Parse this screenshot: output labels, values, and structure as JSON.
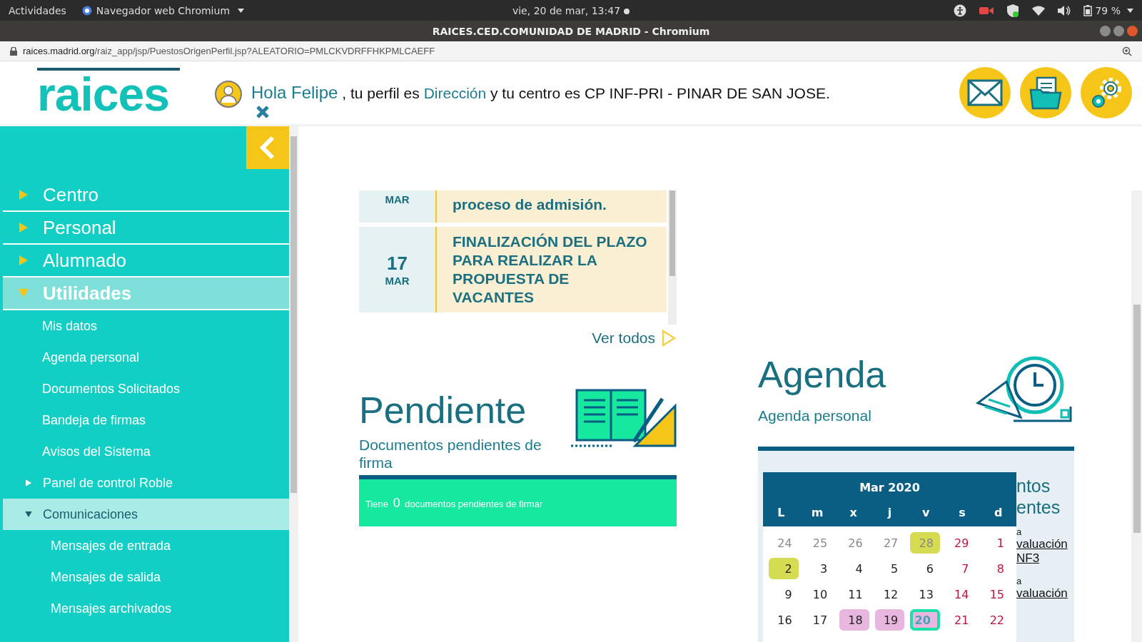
{
  "system_bar": {
    "activities": "Actividades",
    "app_menu": "Navegador web Chromium",
    "clock": "vie, 20 de mar, 13:47",
    "battery": "79 %"
  },
  "window": {
    "title": "RAICES.CED.COMUNIDAD DE MADRID - Chromium"
  },
  "address_bar": {
    "domain": "raices.madrid.org",
    "path": "/raiz_app/jsp/PuestosOrigenPerfil.jsp?ALEATORIO=PMLCKVDRFFHKPMLCAEFF"
  },
  "header": {
    "logo": "raices",
    "greeting": "Hola Felipe",
    "text_1": ", tu perfil es",
    "profile": "Dirección",
    "text_2": "y tu centro es CP INF-PRI - PINAR DE SAN JOSE."
  },
  "sidebar": {
    "items": [
      {
        "label": "Centro",
        "expanded": false,
        "selected": false
      },
      {
        "label": "Personal",
        "expanded": false,
        "selected": false
      },
      {
        "label": "Alumnado",
        "expanded": false,
        "selected": false
      },
      {
        "label": "Utilidades",
        "expanded": true,
        "selected": true,
        "children": [
          {
            "label": "Mis datos",
            "kind": "link",
            "selected": false
          },
          {
            "label": "Agenda personal",
            "kind": "link",
            "selected": false
          },
          {
            "label": "Documentos Solicitados",
            "kind": "link",
            "selected": false
          },
          {
            "label": "Bandeja de firmas",
            "kind": "link",
            "selected": false
          },
          {
            "label": "Avisos del Sistema",
            "kind": "link",
            "selected": false
          },
          {
            "label": "Panel de control Roble",
            "kind": "group",
            "expanded": false,
            "selected": false
          },
          {
            "label": "Comunicaciones",
            "kind": "group",
            "expanded": true,
            "selected": true,
            "children": [
              {
                "label": "Mensajes de entrada",
                "selected": false
              },
              {
                "label": "Mensajes de salida",
                "selected": false
              },
              {
                "label": "Mensajes archivados",
                "selected": false
              }
            ]
          }
        ]
      }
    ]
  },
  "news": [
    {
      "month": "MAR",
      "title": "proceso de admisión."
    },
    {
      "day": "17",
      "month": "MAR",
      "title": "FINALIZACIÓN DEL PLAZO PARA REALIZAR LA PROPUESTA DE VACANTES"
    }
  ],
  "see_all": "Ver todos",
  "pending": {
    "title": "Pendiente",
    "subtitle": "Documentos pendientes de firma",
    "text_before": "Tiene",
    "count": "0",
    "text_after": "documentos pendientes de firmar"
  },
  "agenda": {
    "title": "Agenda",
    "link": "Agenda personal"
  },
  "calendar": {
    "month": "Mar 2020",
    "weekdays": [
      "L",
      "m",
      "x",
      "j",
      "v",
      "s",
      "d"
    ],
    "weeks": [
      [
        {
          "day": "24",
          "kind": "other"
        },
        {
          "day": "25",
          "kind": "other"
        },
        {
          "day": "26",
          "kind": "other"
        },
        {
          "day": "27",
          "kind": "other"
        },
        {
          "day": "28",
          "kind": "other",
          "color": "#d6dc52"
        },
        {
          "day": "29",
          "kind": "weekend"
        },
        {
          "day": "1",
          "kind": "weekend"
        }
      ],
      [
        {
          "day": "2",
          "kind": "day",
          "color": "#d6dc52"
        },
        {
          "day": "3",
          "kind": "day"
        },
        {
          "day": "4",
          "kind": "day"
        },
        {
          "day": "5",
          "kind": "day"
        },
        {
          "day": "6",
          "kind": "day"
        },
        {
          "day": "7",
          "kind": "weekend"
        },
        {
          "day": "8",
          "kind": "weekend"
        }
      ],
      [
        {
          "day": "9",
          "kind": "day"
        },
        {
          "day": "10",
          "kind": "day"
        },
        {
          "day": "11",
          "kind": "day"
        },
        {
          "day": "12",
          "kind": "day"
        },
        {
          "day": "13",
          "kind": "day"
        },
        {
          "day": "14",
          "kind": "weekend"
        },
        {
          "day": "15",
          "kind": "weekend"
        }
      ],
      [
        {
          "day": "16",
          "kind": "day"
        },
        {
          "day": "17",
          "kind": "day"
        },
        {
          "day": "18",
          "kind": "day",
          "color": "#e8b6de"
        },
        {
          "day": "19",
          "kind": "day",
          "color": "#e8b6de"
        },
        {
          "day": "20",
          "kind": "today",
          "color": "#e8b6de"
        },
        {
          "day": "21",
          "kind": "weekend"
        },
        {
          "day": "22",
          "kind": "weekend"
        }
      ]
    ]
  },
  "events_panel": {
    "heading": [
      "ntos",
      "entes"
    ],
    "items": [
      {
        "label": "a",
        "link_lines": [
          "valuación",
          "NF3"
        ]
      },
      {
        "label": "a",
        "link_lines": [
          "valuación"
        ]
      }
    ]
  }
}
